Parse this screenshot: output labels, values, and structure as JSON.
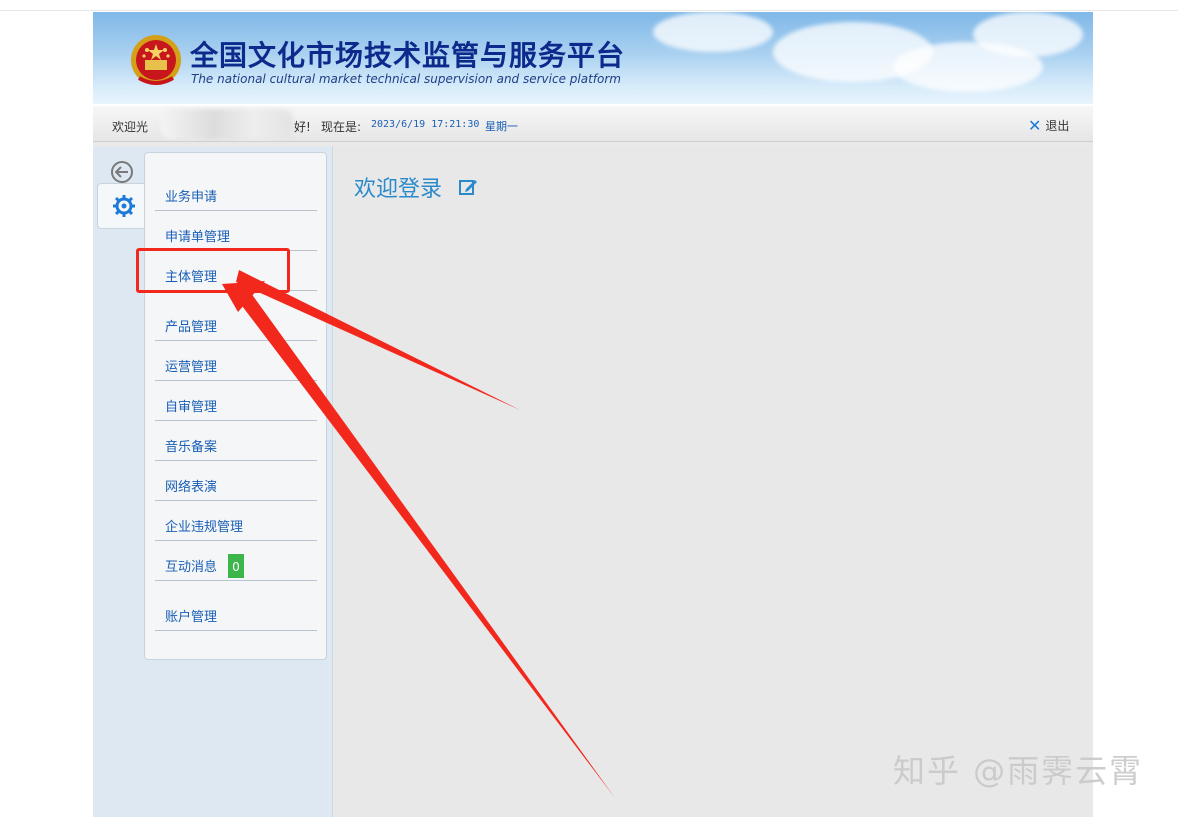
{
  "header": {
    "title": "全国文化市场技术监管与服务平台",
    "subtitle": "The national cultural market technical supervision and service platform"
  },
  "statusbar": {
    "welcome_prefix": "欢迎光",
    "welcome_suffix": "好!",
    "now_label": "现在是:",
    "datetime": "2023/6/19 17:21:30",
    "weekday": "星期一",
    "logout_label": "退出"
  },
  "menu": {
    "items": [
      {
        "label": "业务申请"
      },
      {
        "label": "申请单管理"
      },
      {
        "label": "主体管理"
      },
      {
        "label": "产品管理"
      },
      {
        "label": "运营管理"
      },
      {
        "label": "自审管理"
      },
      {
        "label": "音乐备案"
      },
      {
        "label": "网络表演"
      },
      {
        "label": "企业违规管理"
      },
      {
        "label": "互动消息",
        "badge": "0"
      },
      {
        "label": "账户管理"
      }
    ]
  },
  "content": {
    "welcome_title": "欢迎登录"
  },
  "watermark": "知乎 @雨霁云霄",
  "colors": {
    "accent_blue": "#1a5fb4",
    "title_blue": "#0b2a8c",
    "annotation_red": "#f2281d",
    "badge_green": "#3cb54a"
  },
  "icons": [
    "national-emblem-icon",
    "back-arrow-icon",
    "gear-icon",
    "close-x-icon",
    "edit-icon"
  ]
}
